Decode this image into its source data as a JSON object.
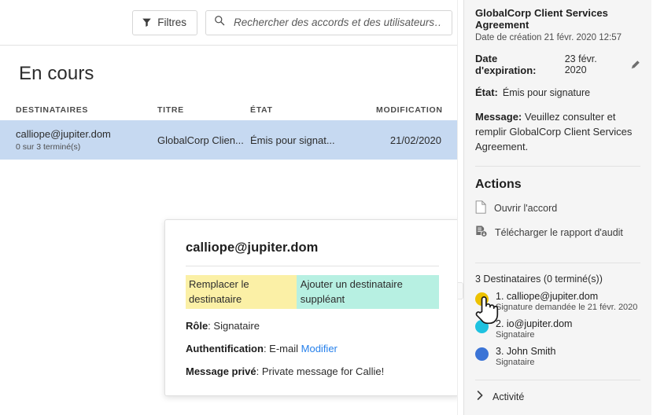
{
  "toolbar": {
    "filters_label": "Filtres",
    "filter_icon": "funnel-icon",
    "search_icon": "search-icon",
    "search_placeholder": "Rechercher des accords et des utilisateurs…",
    "search_value": ""
  },
  "main": {
    "page_title": "En cours",
    "columns": [
      "DESTINATAIRES",
      "TITRE",
      "ÉTAT",
      "MODIFICATION"
    ],
    "rows": [
      {
        "recipient": "calliope@jupiter.dom",
        "recipient_sub": "0 sur 3 terminé(s)",
        "title": "GlobalCorp Clien...",
        "state": "Émis pour signat...",
        "modified": "21/02/2020",
        "selected": true
      }
    ]
  },
  "popup": {
    "title": "calliope@jupiter.dom",
    "action_replace": "Remplacer le destinataire",
    "action_add_delegate": "Ajouter un destinataire suppléant",
    "role_label": "Rôle",
    "role_value": "Signataire",
    "auth_label": "Authentification",
    "auth_value": "E-mail",
    "auth_link": "Modifier",
    "private_msg_label": "Message privé",
    "private_msg_value": "Private message for Callie!",
    "highlight_yellow": "#fbf0a6",
    "highlight_cyan": "#b7f0e2"
  },
  "rail": {
    "agreement_title": "GlobalCorp Client Services Agreement",
    "created_label": "Date de création 21 févr. 2020 12:57",
    "expiry_label": "Date d'expiration:",
    "expiry_value": "23 févr. 2020",
    "expiry_edit_icon": "pencil-icon",
    "state_label": "État:",
    "state_value": "Émis pour signature",
    "message_label": "Message:",
    "message_value": "Veuillez consulter et remplir GlobalCorp Client Services Agreement.",
    "actions_heading": "Actions",
    "actions": [
      {
        "icon": "document-icon",
        "label": "Ouvrir l'accord"
      },
      {
        "icon": "audit-report-download-icon",
        "label": "Télécharger le rapport d'audit"
      }
    ],
    "recipients_heading": "3 Destinataires (0 terminé(s))",
    "recipients": [
      {
        "name": "1. calliope@jupiter.dom",
        "sub": "Signature demandée le 21 févr. 2020",
        "color": "#edc200"
      },
      {
        "name": "2. io@jupiter.dom",
        "sub": "Signataire",
        "color": "#1ec2e0"
      },
      {
        "name": "3. John Smith",
        "sub": "Signataire",
        "color": "#3b74d6"
      }
    ],
    "activity_label": "Activité",
    "activity_icon": "chevron-right-icon"
  },
  "cursor": {
    "icon": "hand-pointer-cursor"
  }
}
